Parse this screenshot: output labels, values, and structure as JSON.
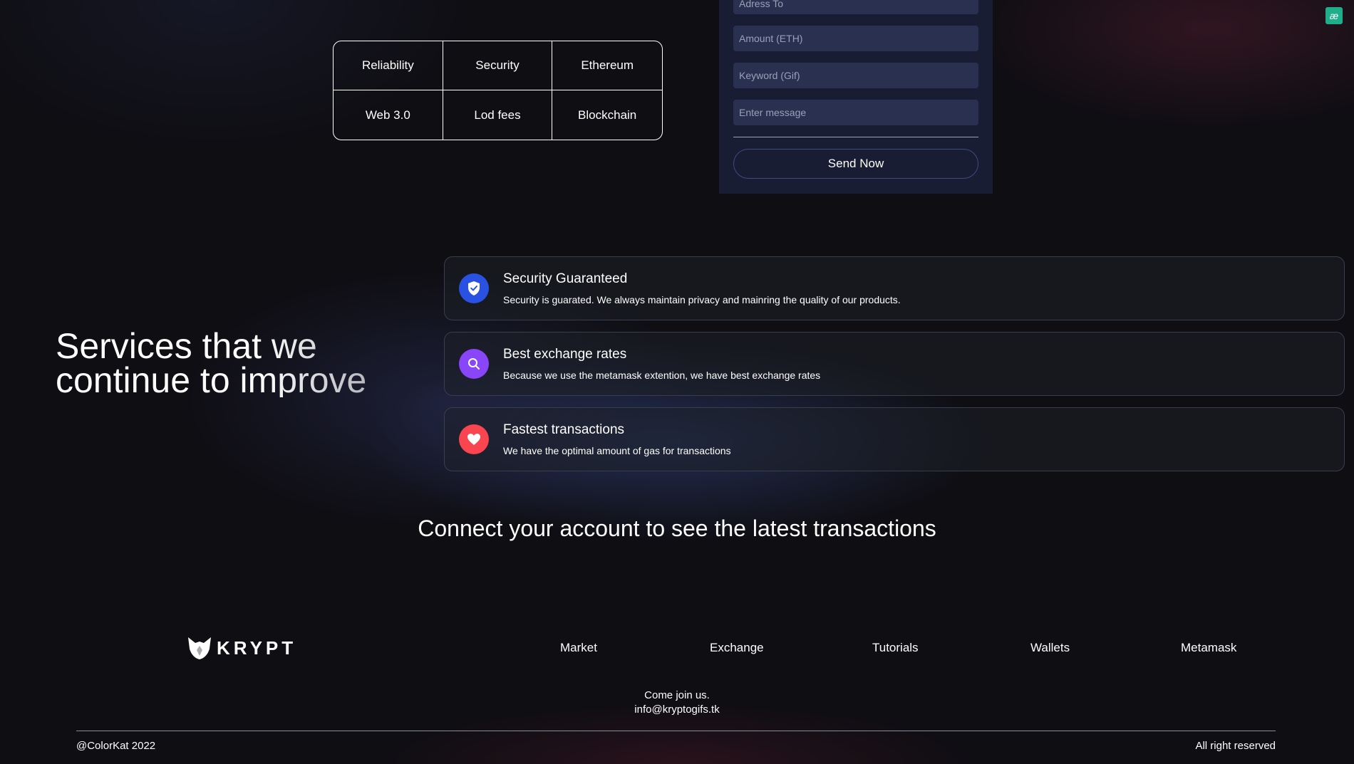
{
  "features": [
    "Reliability",
    "Security",
    "Ethereum",
    "Web 3.0",
    "Lod fees",
    "Blockchain"
  ],
  "form": {
    "address_placeholder": "Adress To",
    "amount_placeholder": "Amount (ETH)",
    "keyword_placeholder": "Keyword (Gif)",
    "message_placeholder": "Enter message",
    "send_label": "Send Now"
  },
  "services": {
    "title": "Services that we continue to improve",
    "items": [
      {
        "title": "Security Guaranteed",
        "desc": "Security is guarated. We always maintain privacy and mainring the quality of our products.",
        "color": "#2952e3",
        "icon": "shield-check-icon"
      },
      {
        "title": "Best exchange rates",
        "desc": "Because we use the metamask extention, we have best exchange rates",
        "color": "#8945f8",
        "icon": "search-icon"
      },
      {
        "title": "Fastest transactions",
        "desc": "We have the optimal amount of gas for transactions",
        "color": "#f84550",
        "icon": "heart-icon"
      }
    ]
  },
  "transactions": {
    "connect_text": "Connect your account to see the latest transactions"
  },
  "footer": {
    "logo_text": "KRYPT",
    "nav": [
      "Market",
      "Exchange",
      "Tutorials",
      "Wallets",
      "Metamask"
    ],
    "join_text": "Come join us.",
    "email": "info@kryptogifs.tk",
    "copyright": "@ColorKat 2022",
    "rights": "All right reserved"
  },
  "extension_badge": "æ"
}
